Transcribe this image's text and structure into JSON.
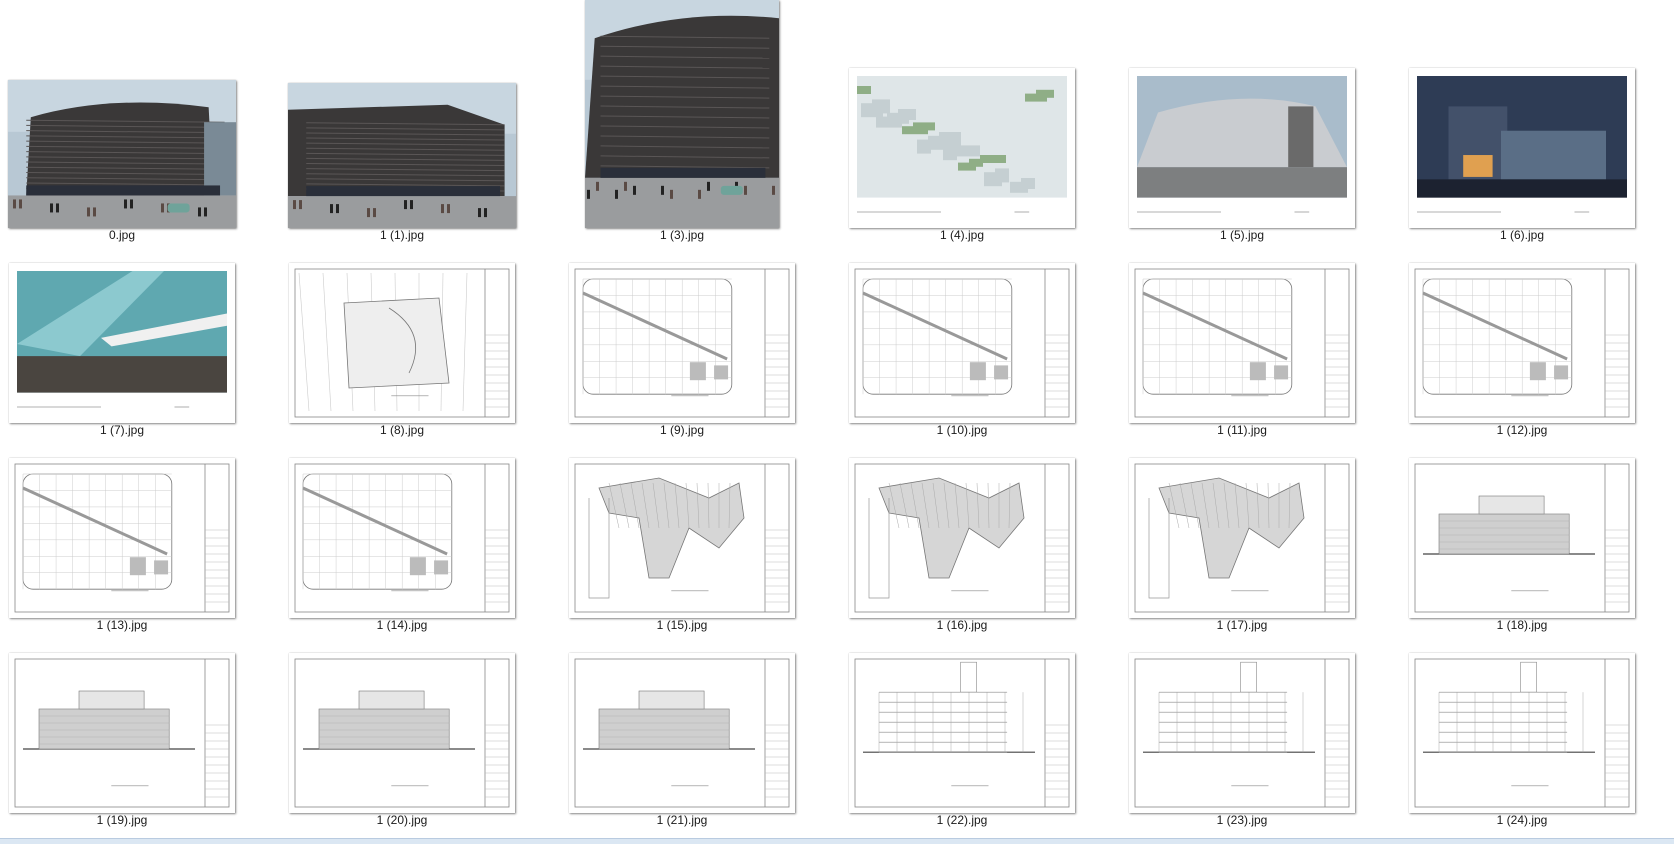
{
  "window": {
    "view": "extra-large-icons",
    "accent_color": "#dbe7f3"
  },
  "thumbnails": [
    {
      "name": "0.jpg",
      "kind": "photo",
      "variant": "mall-facade-wide"
    },
    {
      "name": "1 (1).jpg",
      "kind": "photo",
      "variant": "mall-facade-side"
    },
    {
      "name": "1 (3).jpg",
      "kind": "photo",
      "variant": "mall-facade-tall"
    },
    {
      "name": "1 (4).jpg",
      "kind": "render",
      "variant": "aerial-render"
    },
    {
      "name": "1 (5).jpg",
      "kind": "render",
      "variant": "street-render"
    },
    {
      "name": "1 (6).jpg",
      "kind": "render",
      "variant": "night-render"
    },
    {
      "name": "1 (7).jpg",
      "kind": "render",
      "variant": "atrium-render"
    },
    {
      "name": "1 (8).jpg",
      "kind": "drawing",
      "variant": "site-plan"
    },
    {
      "name": "1 (9).jpg",
      "kind": "drawing",
      "variant": "floor-plan"
    },
    {
      "name": "1 (10).jpg",
      "kind": "drawing",
      "variant": "floor-plan"
    },
    {
      "name": "1 (11).jpg",
      "kind": "drawing",
      "variant": "floor-plan"
    },
    {
      "name": "1 (12).jpg",
      "kind": "drawing",
      "variant": "floor-plan"
    },
    {
      "name": "1 (13).jpg",
      "kind": "drawing",
      "variant": "floor-plan"
    },
    {
      "name": "1 (14).jpg",
      "kind": "drawing",
      "variant": "floor-plan"
    },
    {
      "name": "1 (15).jpg",
      "kind": "drawing",
      "variant": "roof-plan"
    },
    {
      "name": "1 (16).jpg",
      "kind": "drawing",
      "variant": "roof-plan"
    },
    {
      "name": "1 (17).jpg",
      "kind": "drawing",
      "variant": "roof-plan"
    },
    {
      "name": "1 (18).jpg",
      "kind": "drawing",
      "variant": "elevation"
    },
    {
      "name": "1 (19).jpg",
      "kind": "drawing",
      "variant": "elevation"
    },
    {
      "name": "1 (20).jpg",
      "kind": "drawing",
      "variant": "elevation"
    },
    {
      "name": "1 (21).jpg",
      "kind": "drawing",
      "variant": "elevation"
    },
    {
      "name": "1 (22).jpg",
      "kind": "drawing",
      "variant": "section"
    },
    {
      "name": "1 (23).jpg",
      "kind": "drawing",
      "variant": "section"
    },
    {
      "name": "1 (24).jpg",
      "kind": "drawing",
      "variant": "section"
    }
  ]
}
